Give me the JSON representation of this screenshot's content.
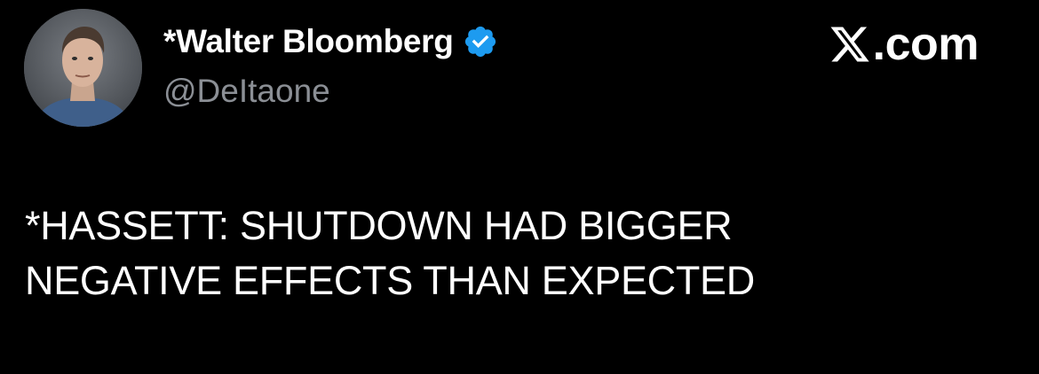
{
  "author": {
    "display_name": "*Walter Bloomberg",
    "handle": "@DeItaone",
    "avatar_icon": "profile-photo",
    "verified_icon": "verified-badge-icon",
    "verified_color": "#1d9bf0"
  },
  "brand": {
    "logo_icon": "x-logo-icon",
    "label": ".com"
  },
  "tweet": {
    "lines": [
      "*HASSETT: SHUTDOWN HAD BIGGER",
      "NEGATIVE EFFECTS THAN EXPECTED"
    ]
  },
  "colors": {
    "background": "#000000",
    "text": "#ffffff",
    "secondary_text": "#8b8f95"
  }
}
